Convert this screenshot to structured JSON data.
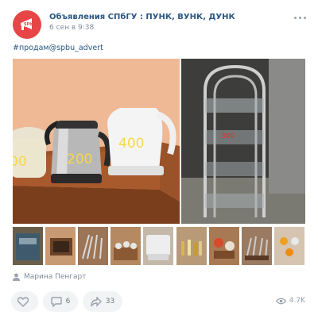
{
  "group": {
    "name": "Объявления СПбГУ : ПУНК, ВУНК, ДУНК",
    "date": "6 сен в 9:38",
    "avatar_icon": "megaphone-icon",
    "accent": "#e64646"
  },
  "post": {
    "text": "#продам@spbu_advert",
    "photos": {
      "left": {
        "price_labels": [
          "00",
          "200",
          "400"
        ],
        "label_color": "#f5d84a"
      },
      "right": {
        "price_label": "300",
        "label_color": "#d9302a"
      },
      "thumbnail_count": 9
    },
    "author": "Марина Пенгарт"
  },
  "actions": {
    "like_count": "",
    "comment_count": "6",
    "share_count": "33",
    "views": "4.7K"
  }
}
